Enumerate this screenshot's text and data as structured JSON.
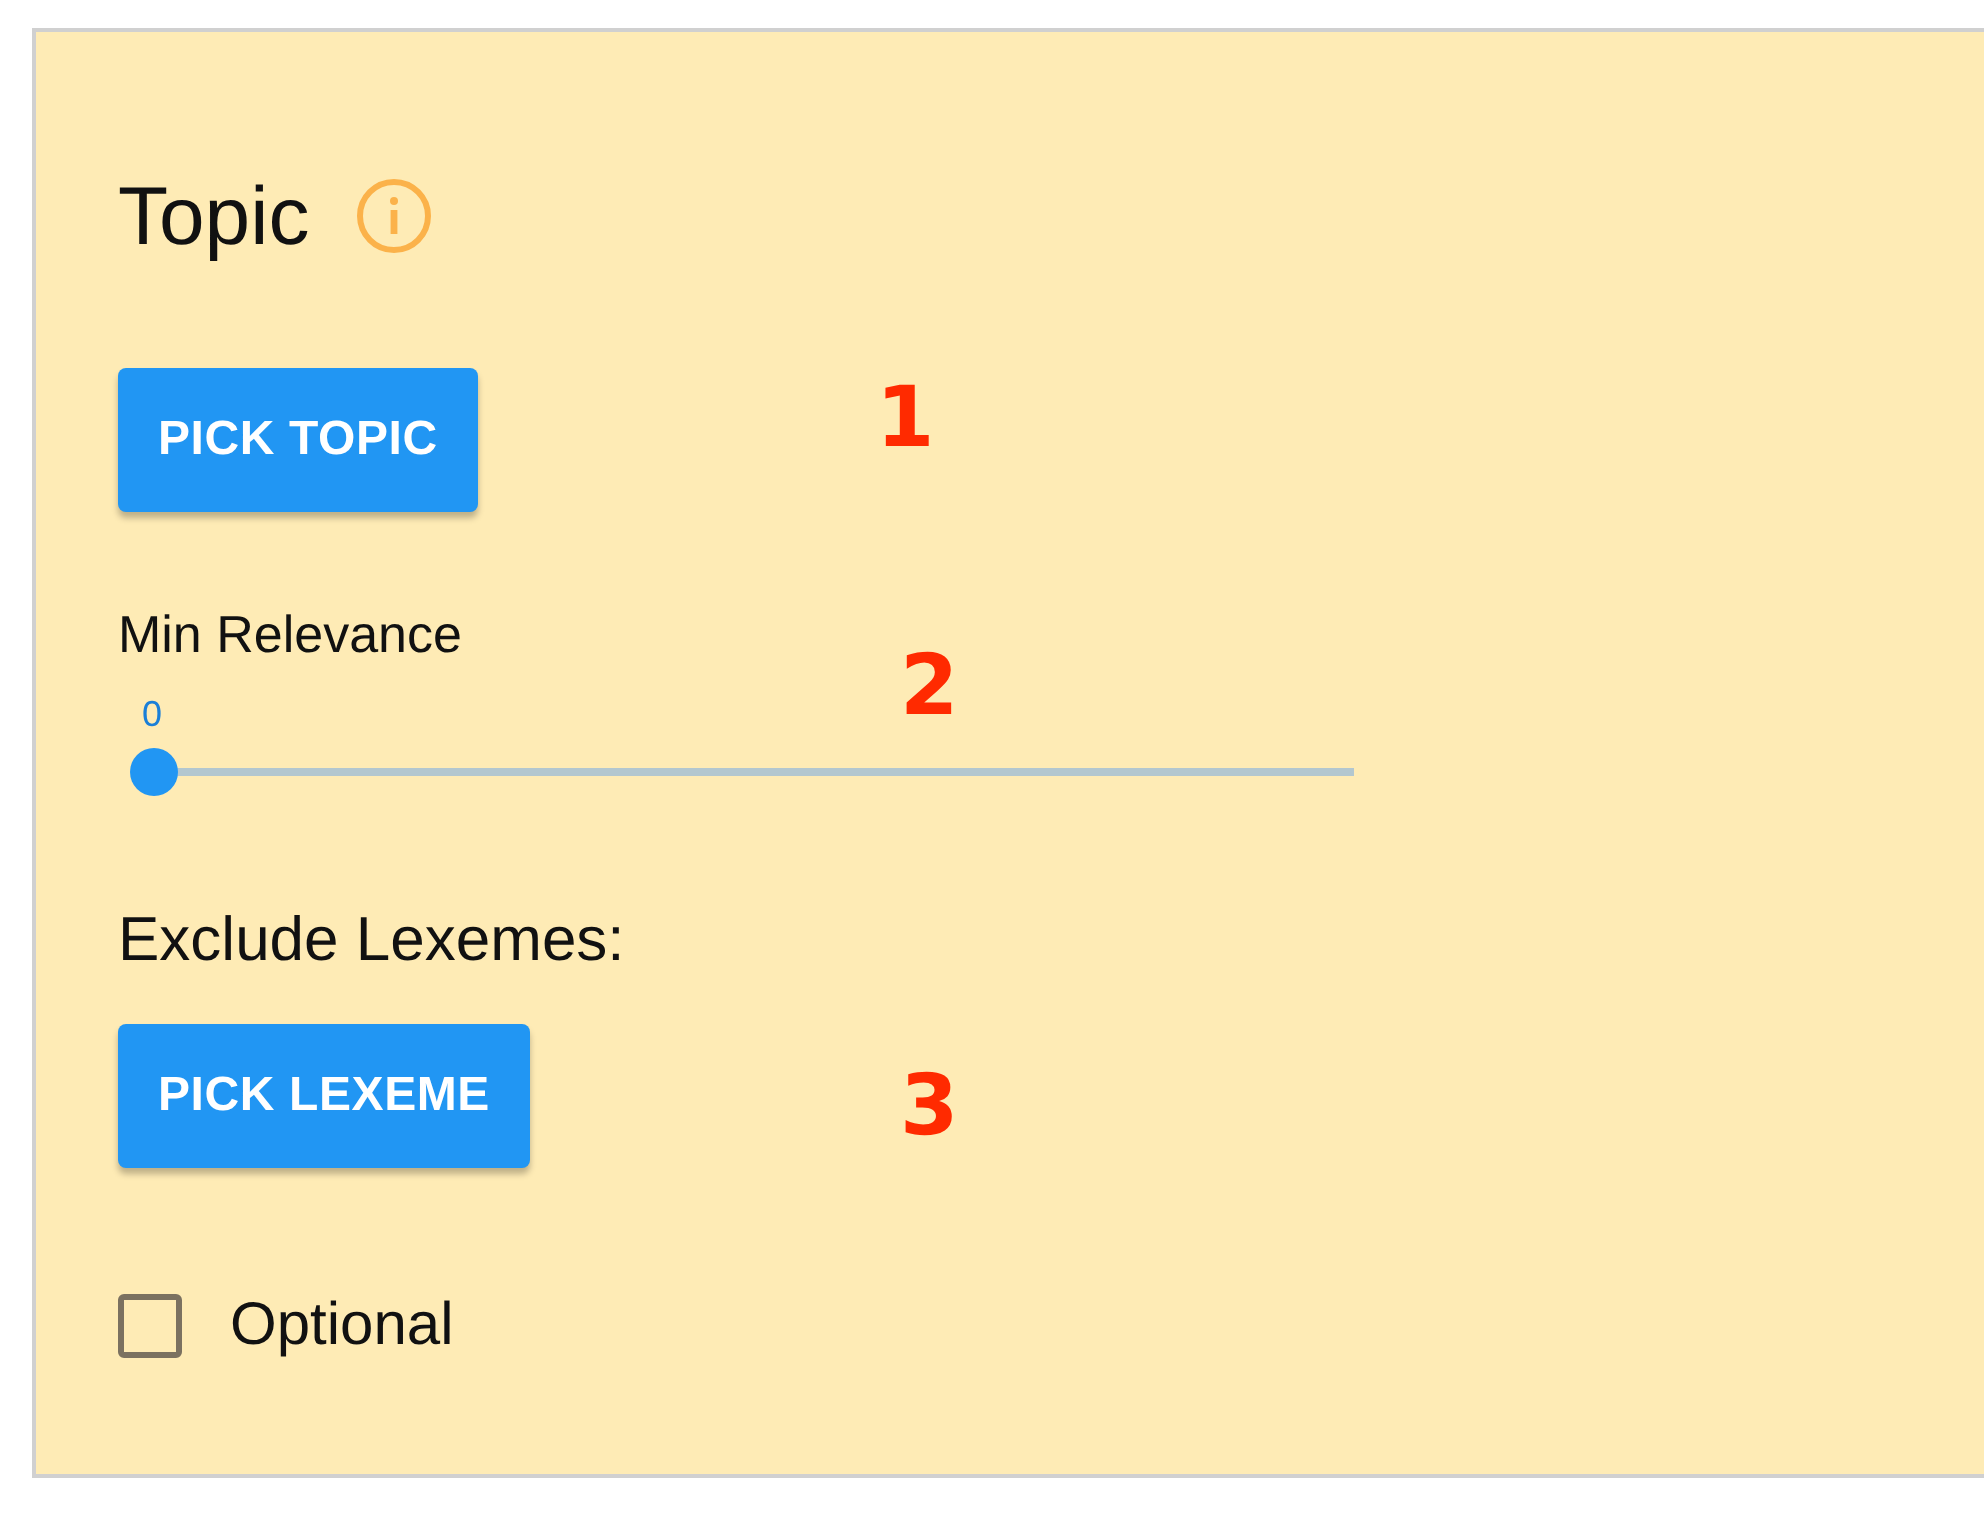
{
  "panel": {
    "title": "Topic",
    "pick_topic_button": "PICK TOPIC",
    "min_relevance": {
      "label": "Min Relevance",
      "reading": "0",
      "level": 0
    },
    "exclude_label": "Exclude Lexemes:",
    "pick_lexeme_button": "PICK LEXEME",
    "optional": {
      "label": "Optional",
      "checked": false
    }
  },
  "annotations": [
    "1",
    "2",
    "3"
  ]
}
